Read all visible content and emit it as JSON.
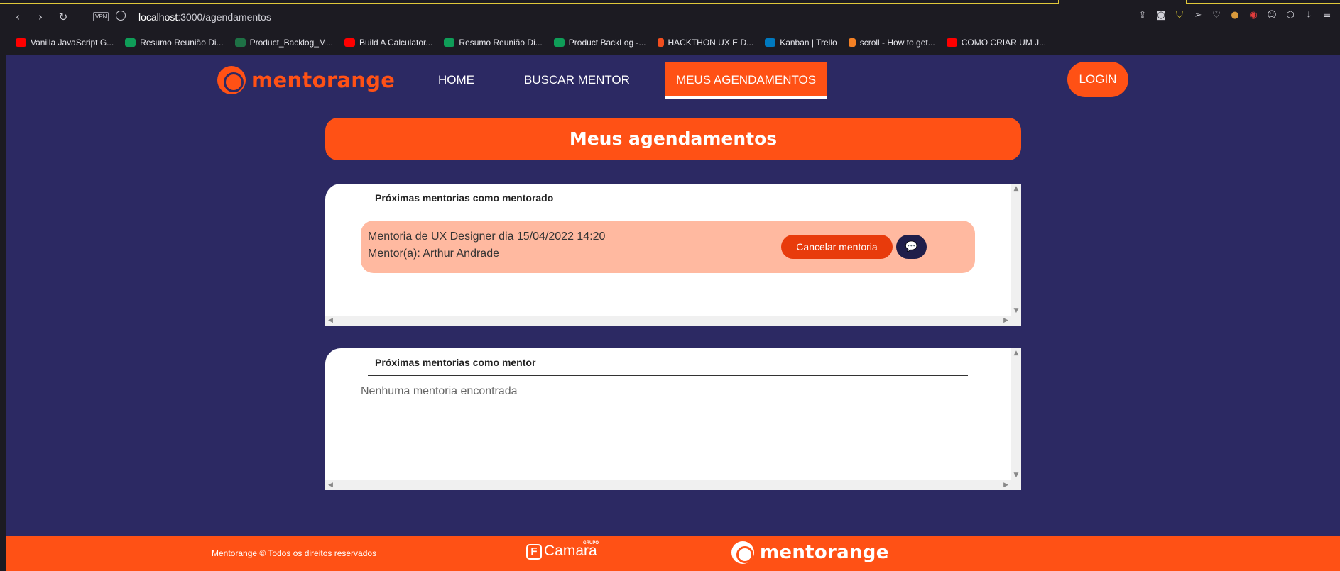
{
  "browser": {
    "vpn_label": "VPN",
    "url_host": "localhost",
    "url_path": ":3000/agendamentos",
    "nav": {
      "back": "‹",
      "forward": "›",
      "reload": "↻"
    },
    "toolbar_icons": [
      "share-icon",
      "camera-icon",
      "shield-icon",
      "send-icon",
      "heart-icon",
      "cookie-icon",
      "record-icon",
      "cat-icon",
      "cube-icon",
      "download-icon",
      "menu-icon"
    ]
  },
  "bookmarks": [
    {
      "label": "Vanilla JavaScript G...",
      "icon": "youtube-icon",
      "color": "#ff0000"
    },
    {
      "label": "Resumo Reunião Di...",
      "icon": "sheets-icon",
      "color": "#0f9d58"
    },
    {
      "label": "Product_Backlog_M...",
      "icon": "excel-icon",
      "color": "#1e7145"
    },
    {
      "label": "Build A Calculator...",
      "icon": "youtube-icon",
      "color": "#ff0000"
    },
    {
      "label": "Resumo Reunião Di...",
      "icon": "sheets-icon",
      "color": "#0f9d58"
    },
    {
      "label": "Product BackLog -...",
      "icon": "sheets-icon",
      "color": "#0f9d58"
    },
    {
      "label": "HACKTHON UX E D...",
      "icon": "figma-icon",
      "color": "#f24e1e"
    },
    {
      "label": "Kanban | Trello",
      "icon": "trello-icon",
      "color": "#0079bf"
    },
    {
      "label": "scroll - How to get...",
      "icon": "stackoverflow-icon",
      "color": "#f48024"
    },
    {
      "label": "COMO CRIAR UM J...",
      "icon": "youtube-icon",
      "color": "#ff0000"
    }
  ],
  "site": {
    "brand": "mentorange",
    "nav": {
      "home": "HOME",
      "buscar": "BUSCAR MENTOR",
      "agendamentos": "MEUS AGENDAMENTOS"
    },
    "login": "LOGIN",
    "page_title": "Meus agendamentos"
  },
  "sections": {
    "mentorado": {
      "heading": "Próximas mentorias como mentorado",
      "items": [
        {
          "line1": "Mentoria de UX Designer dia 15/04/2022 14:20",
          "line2": "Mentor(a): Arthur Andrade",
          "cancel_label": "Cancelar mentoria",
          "chat_icon": "chat-icon"
        }
      ]
    },
    "mentor": {
      "heading": "Próximas mentorias como mentor",
      "empty_text": "Nenhuma mentoria encontrada"
    }
  },
  "footer": {
    "copyright": "Mentorange © Todos os direitos reservados",
    "partner_prefix": "GRUPO",
    "partner_name": "Camara",
    "brand": "mentorange"
  },
  "colors": {
    "orange": "#ff5115",
    "navy": "#2c2963",
    "card": "#ffb9a0",
    "cancel": "#e83b0c",
    "chat": "#1f1e4a"
  }
}
